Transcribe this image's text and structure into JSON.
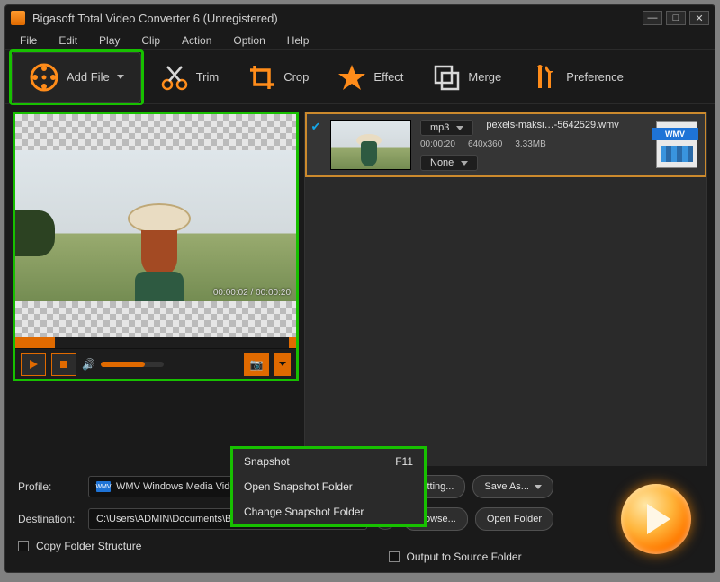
{
  "window": {
    "title": "Bigasoft Total Video Converter 6 (Unregistered)"
  },
  "menu": {
    "file": "File",
    "edit": "Edit",
    "play": "Play",
    "clip": "Clip",
    "action": "Action",
    "option": "Option",
    "help": "Help"
  },
  "toolbar": {
    "addfile": "Add File",
    "trim": "Trim",
    "crop": "Crop",
    "effect": "Effect",
    "merge": "Merge",
    "pref": "Preference"
  },
  "preview": {
    "time": "00:00:02 / 00:00:20"
  },
  "file": {
    "name": "pexels-maksi…-5642529.wmv",
    "format_sel": "mp3",
    "subtitle_sel": "None",
    "duration": "00:00:20",
    "resolution": "640x360",
    "size": "3.33MB",
    "badge": "WMV"
  },
  "snapshot_menu": {
    "snap": "Snapshot",
    "snap_key": "F11",
    "open": "Open Snapshot Folder",
    "change": "Change Snapshot Folder"
  },
  "bottom": {
    "profile_label": "Profile:",
    "profile_value": "WMV Windows Media Vide",
    "profile_badge": "WMV",
    "dest_label": "Destination:",
    "dest_value": "C:\\Users\\ADMIN\\Documents\\B",
    "setting": "Setting...",
    "saveas": "Save As...",
    "browse": "Browse...",
    "openfolder": "Open Folder",
    "copyfolder": "Copy Folder Structure",
    "outputsrc": "Output to Source Folder"
  }
}
